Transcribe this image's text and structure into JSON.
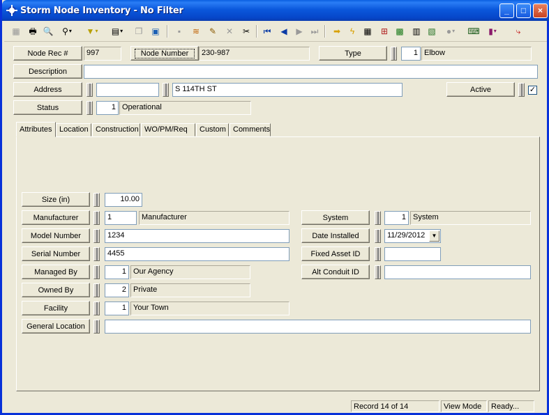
{
  "window": {
    "title": "Storm Node Inventory - No Filter",
    "controls": {
      "minimize": "_",
      "maximize": "□",
      "close": "×"
    }
  },
  "toolbar": {
    "icons": [
      "new-record-icon",
      "print-icon",
      "print-preview-icon",
      "search-icon",
      "filter-icon",
      "view-icon",
      "copy-icon",
      "paste-icon",
      "save-icon",
      "stack-icon",
      "edit-icon",
      "delete-icon",
      "cut-icon",
      "first-record-icon",
      "previous-record-icon",
      "next-record-icon",
      "last-record-icon",
      "go-to-icon",
      "lightning-icon",
      "map-icon",
      "tree-icon",
      "gis-icon",
      "calculator-icon",
      "layout-icon",
      "globe-icon",
      "keyboard-icon",
      "books-icon",
      "exit-icon"
    ]
  },
  "header": {
    "node_rec_label": "Node Rec #",
    "node_rec_value": "997",
    "node_number_label": "Node Number",
    "node_number_value": "230-987",
    "type_label": "Type",
    "type_code": "1",
    "type_value": "Elbow",
    "description_label": "Description",
    "description_value": "",
    "address_label": "Address",
    "address_number": "",
    "address_street": "S 114TH ST",
    "active_label": "Active",
    "active_checked": "✓",
    "status_label": "Status",
    "status_code": "1",
    "status_value": "Operational"
  },
  "tabs": [
    "Attributes",
    "Location",
    "Construction",
    "WO/PM/Req",
    "Custom",
    "Comments"
  ],
  "attributes": {
    "size_label": "Size (in)",
    "size_value": "10.00",
    "manufacturer_label": "Manufacturer",
    "manufacturer_code": "1",
    "manufacturer_value": "Manufacturer",
    "model_label": "Model Number",
    "model_value": "1234",
    "serial_label": "Serial Number",
    "serial_value": "4455",
    "managed_label": "Managed By",
    "managed_code": "1",
    "managed_value": "Our Agency",
    "owned_label": "Owned By",
    "owned_code": "2",
    "owned_value": "Private",
    "facility_label": "Facility",
    "facility_code": "1",
    "facility_value": "Your Town",
    "general_location_label": "General Location",
    "general_location_value": "",
    "system_label": "System",
    "system_code": "1",
    "system_value": "System",
    "date_installed_label": "Date Installed",
    "date_installed_value": "11/29/2012",
    "fixed_asset_label": "Fixed Asset ID",
    "fixed_asset_value": "",
    "alt_conduit_label": "Alt Conduit ID",
    "alt_conduit_value": ""
  },
  "status": {
    "record": "Record 14 of 14",
    "mode": "View Mode",
    "ready": "Ready..."
  }
}
